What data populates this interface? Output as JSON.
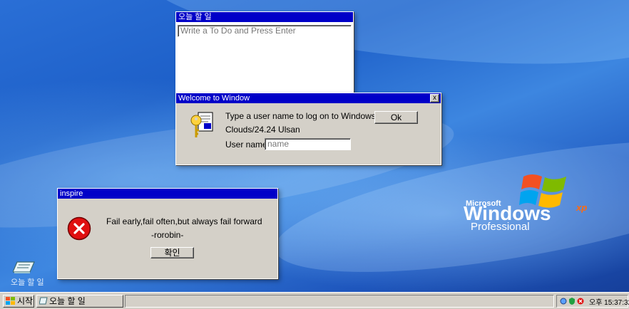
{
  "todo_window": {
    "title": "오늘 할 일",
    "input_placeholder": "Write a To Do and Press Enter"
  },
  "welcome_dialog": {
    "title": "Welcome to Window",
    "close_label": "x",
    "message": "Type a user name to log on to Windows.",
    "location": "Clouds/24.24 Ulsan",
    "username_label": "User name:",
    "username_placeholder": "name",
    "ok_label": "Ok"
  },
  "inspire_dialog": {
    "title": "inspire",
    "quote": "Fail early,fail often,but always fail forward",
    "author": "-rorobin-",
    "confirm_label": "확인"
  },
  "desktop_icon": {
    "label": "오늘 할 일"
  },
  "logo": {
    "microsoft": "Microsoft",
    "windows": "Windows",
    "xp": "xp",
    "edition": "Professional"
  },
  "taskbar": {
    "start_label": "시작",
    "tasks": [
      {
        "label": "오늘 할 일"
      }
    ],
    "clock": "오후 15:37:32"
  },
  "colors": {
    "title_bar": "#0000c8",
    "window_face": "#d4d0c8",
    "desktop_blue": "#1d5fc8",
    "error_red": "#e01010"
  }
}
